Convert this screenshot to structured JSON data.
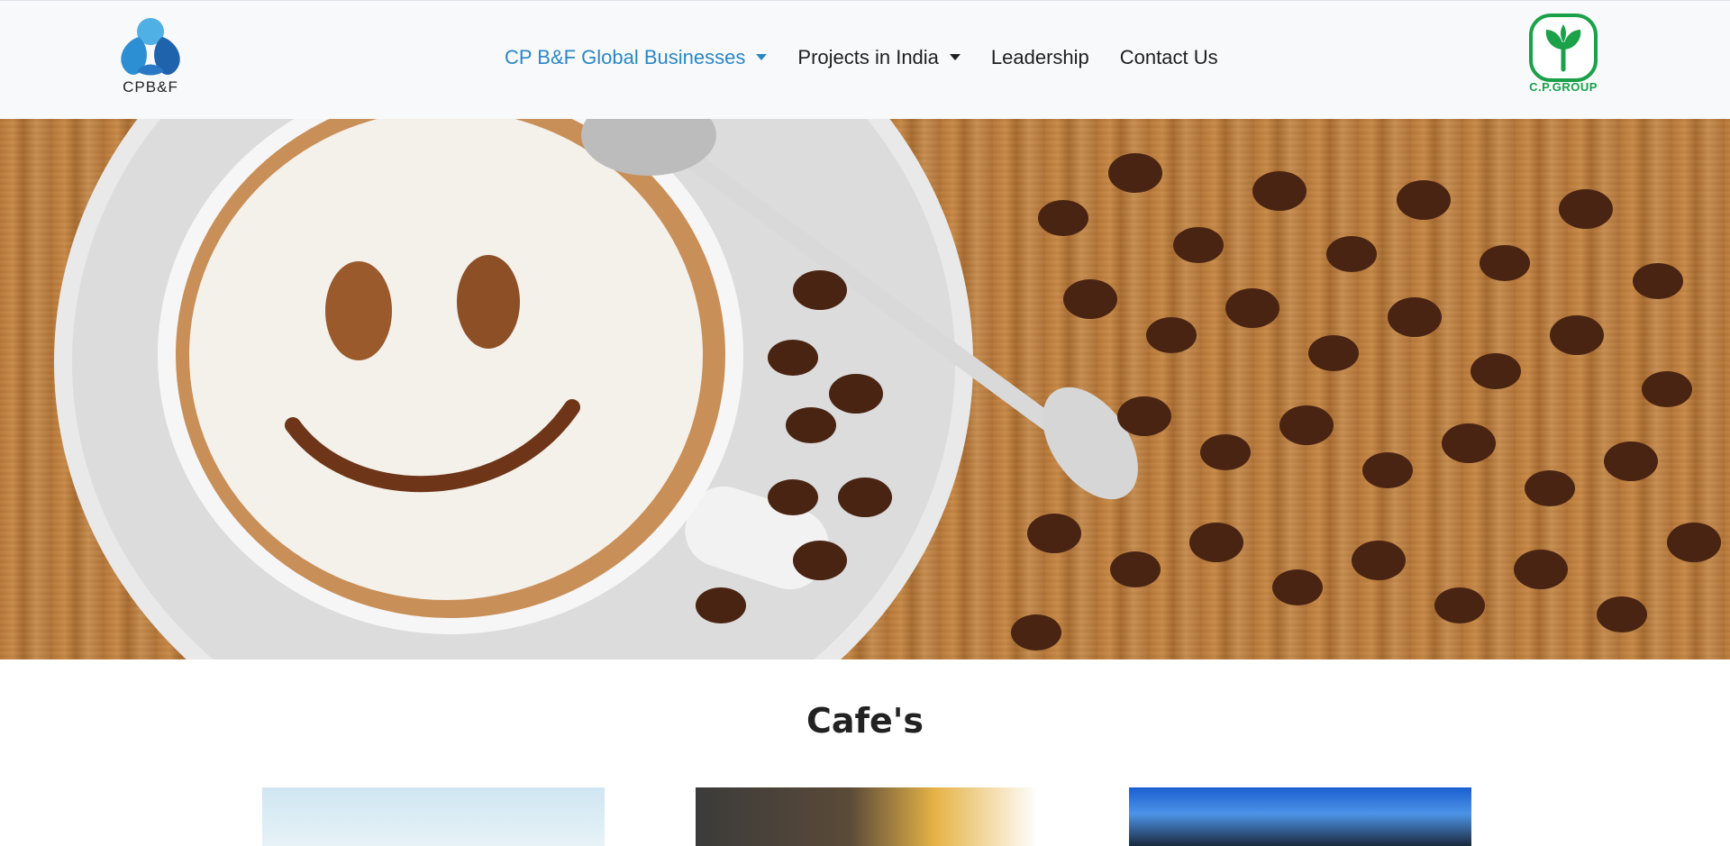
{
  "header": {
    "brand_text": "CPB&F",
    "nav": [
      {
        "label": "CP B&F Global Businesses",
        "dropdown": true,
        "active": true
      },
      {
        "label": "Projects in India",
        "dropdown": true,
        "active": false
      },
      {
        "label": "Leadership",
        "dropdown": false,
        "active": false
      },
      {
        "label": "Contact Us",
        "dropdown": false,
        "active": false
      }
    ],
    "cp_logo_text": "C.P.GROUP"
  },
  "hero": {
    "image": "latte-smiley-coffee-beans"
  },
  "section": {
    "title": "Cafe's"
  },
  "cards": [
    {
      "image": "dessert-drink-photo"
    },
    {
      "image": "burger-fries-photo"
    },
    {
      "image": "bakery-boxes-photo"
    }
  ],
  "colors": {
    "nav_active": "#2b87c4",
    "nav_text": "#1f1f1f",
    "header_bg": "#f8f9fa",
    "cp_green": "#1aa14a",
    "brand_blue": "#2b8fd0"
  }
}
